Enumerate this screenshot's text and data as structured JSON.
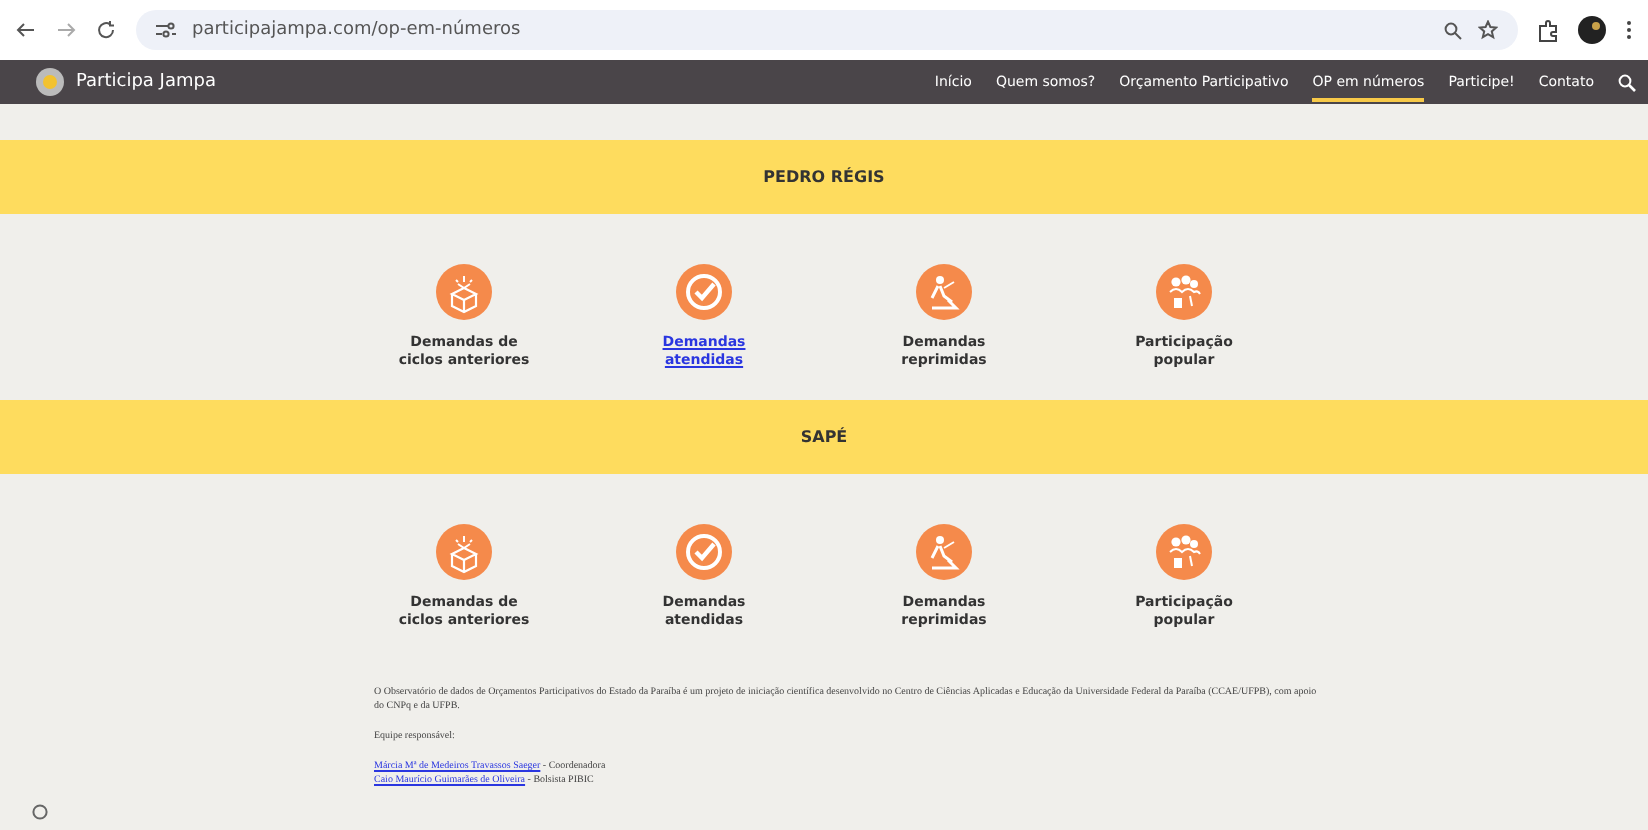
{
  "browser": {
    "url": "participajampa.com/op-em-números"
  },
  "site": {
    "name": "Participa Jampa",
    "nav": [
      {
        "label": "Início",
        "selected": false
      },
      {
        "label": "Quem somos?",
        "selected": false
      },
      {
        "label": "Orçamento Participativo",
        "selected": false
      },
      {
        "label": "OP em números",
        "selected": true
      },
      {
        "label": "Participe!",
        "selected": false
      },
      {
        "label": "Contato",
        "selected": false
      }
    ]
  },
  "regions": [
    {
      "name": "PEDRO RÉGIS",
      "items": [
        {
          "kind": "box",
          "label": "Demandas de ciclos anteriores",
          "link": false
        },
        {
          "kind": "check",
          "label": "Demandas atendidas",
          "link": true
        },
        {
          "kind": "worker",
          "label": "Demandas reprimidas",
          "link": false
        },
        {
          "kind": "people",
          "label": "Participação popular",
          "link": false
        }
      ]
    },
    {
      "name": "SAPÉ",
      "items": [
        {
          "kind": "box",
          "label": "Demandas de ciclos anteriores",
          "link": false
        },
        {
          "kind": "check",
          "label": "Demandas atendidas",
          "link": false
        },
        {
          "kind": "worker",
          "label": "Demandas reprimidas",
          "link": false
        },
        {
          "kind": "people",
          "label": "Participação popular",
          "link": false
        }
      ]
    }
  ],
  "footer": {
    "paragraph": "O Observatório de dados de Orçamentos Participativos do Estado da Paraíba é um projeto de iniciação científica desenvolvido no Centro de Ciências Aplicadas e Educação da Universidade Federal da Paraíba (CCAE/UFPB), com apoio do CNPq e da UFPB.",
    "team_label": "Equipe responsável:",
    "members": [
      {
        "name": "Márcia Mª de Medeiros Travassos Saeger",
        "role": " - Coordenadora"
      },
      {
        "name": "Caio Maurício Guimarães de Oliveira",
        "role": " - Bolsista PIBIC"
      }
    ]
  }
}
